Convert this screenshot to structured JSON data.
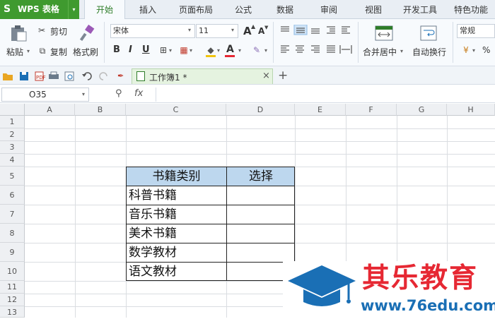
{
  "app": {
    "logo": "S",
    "title": "WPS 表格",
    "arrow": "▾"
  },
  "tabs": [
    "开始",
    "插入",
    "页面布局",
    "公式",
    "数据",
    "审阅",
    "视图",
    "开发工具",
    "特色功能"
  ],
  "ribbon": {
    "paste": "粘贴",
    "cut": "剪切",
    "copy": "复制",
    "format_painter": "格式刷",
    "font_name": "宋体",
    "font_size": "11",
    "grow_font": "A",
    "shrink_font": "A",
    "bold": "B",
    "italic": "I",
    "underline": "U",
    "font_color": "A",
    "merge_center": "合并居中",
    "wrap_text": "自动换行",
    "number_format": "常规",
    "percent": "%"
  },
  "doc": {
    "tab_label": "工作簿1 *",
    "close": "×",
    "add": "+"
  },
  "formula_bar": {
    "name_box": "O35",
    "fx": "fx"
  },
  "columns": [
    "A",
    "B",
    "C",
    "D",
    "E",
    "F",
    "G",
    "H"
  ],
  "rows": [
    "1",
    "2",
    "3",
    "4",
    "5",
    "6",
    "7",
    "8",
    "9",
    "10",
    "11",
    "12",
    "13"
  ],
  "table": {
    "headers": [
      "书籍类别",
      "选择"
    ],
    "header_bg": "#bdd7ee",
    "items": [
      "科普书籍",
      "音乐书籍",
      "美术书籍",
      "数学教材",
      "语文教材"
    ]
  },
  "watermark": {
    "brand": "其乐教育",
    "url": "www.76edu.com",
    "brand_color": "#e62833",
    "cap_color": "#1a6fb5"
  },
  "colors": {
    "wps_green": "#3f9a2f",
    "accent_green": "#2f7d2a"
  }
}
